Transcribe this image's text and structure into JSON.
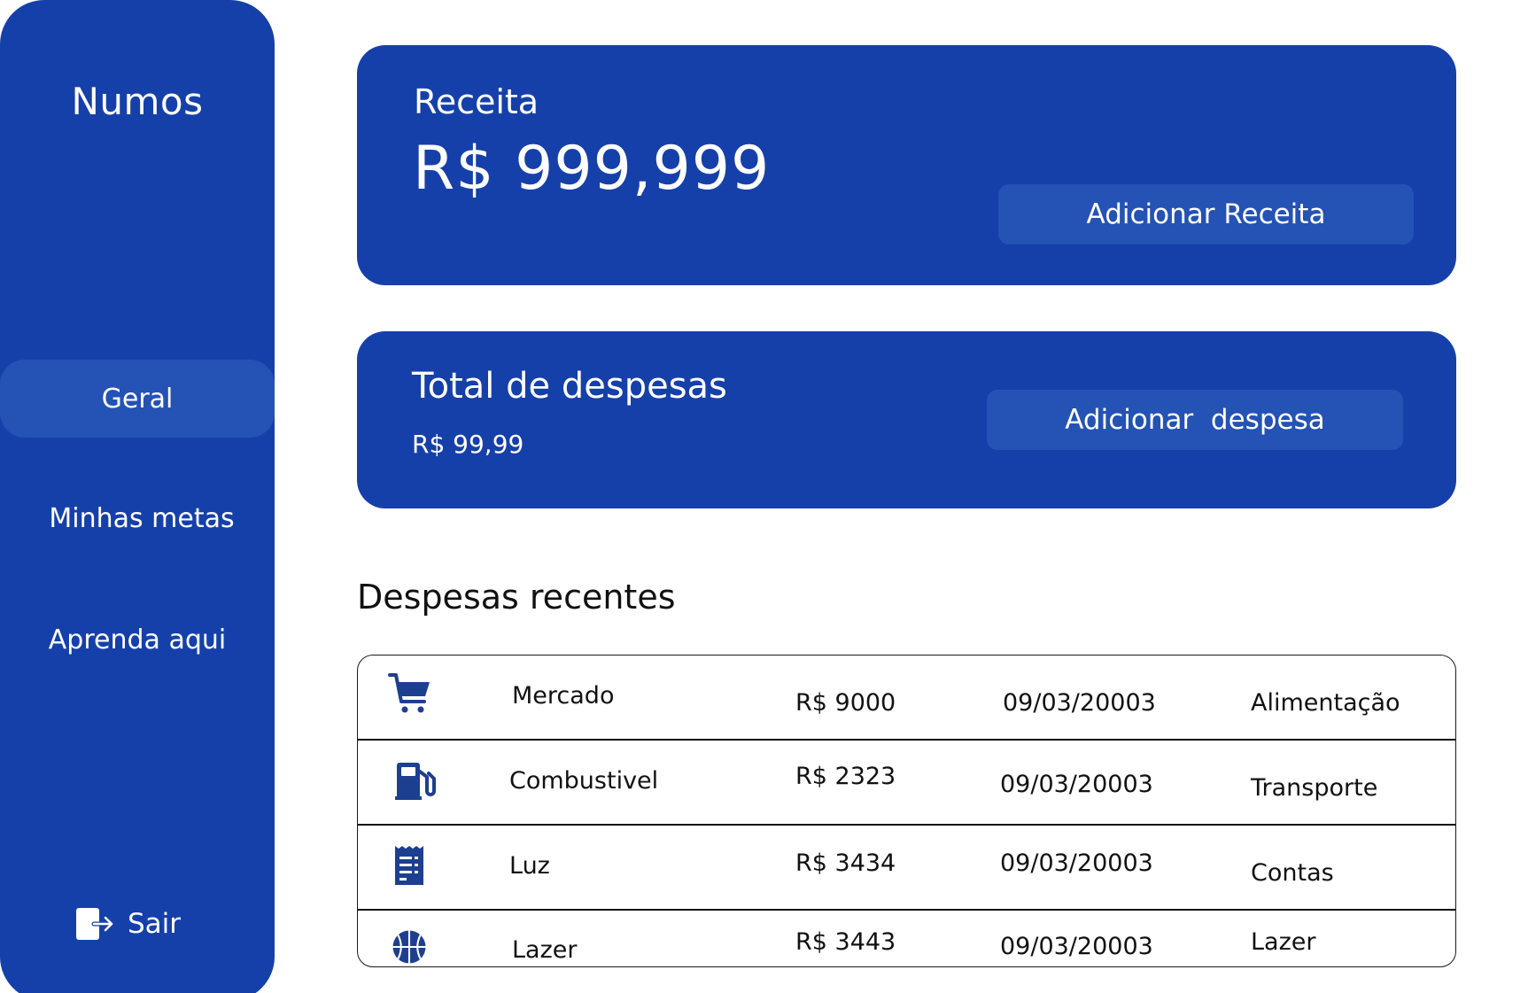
{
  "sidebar": {
    "brand": "Numos",
    "items": [
      {
        "label": "Geral",
        "active": true
      },
      {
        "label": "Minhas metas",
        "active": false
      },
      {
        "label": "Aprenda aqui",
        "active": false
      }
    ],
    "logout_label": "Sair",
    "logout_icon": "logout-icon"
  },
  "receita": {
    "title": "Receita",
    "value": "R$ 999,999",
    "button_label": "Adicionar Receita"
  },
  "despesas": {
    "title": "Total de despesas",
    "value": "R$ 99,99",
    "button_label": "Adicionar  despesa"
  },
  "recent": {
    "title": "Despesas recentes",
    "rows": [
      {
        "icon": "cart-icon",
        "name": "Mercado",
        "amount": "R$ 9000",
        "date": "09/03/20003",
        "category": "Alimentação"
      },
      {
        "icon": "fuel-icon",
        "name": "Combustivel",
        "amount": "R$ 2323",
        "date": "09/03/20003",
        "category": "Transporte"
      },
      {
        "icon": "receipt-icon",
        "name": "Luz",
        "amount": "R$ 3434",
        "date": "09/03/20003",
        "category": "Contas"
      },
      {
        "icon": "basketball-icon",
        "name": "Lazer",
        "amount": "R$ 3443",
        "date": "09/03/20003",
        "category": "Lazer"
      }
    ]
  },
  "colors": {
    "primary": "#1640a9",
    "primary_light": "#2452b5",
    "icon": "#1d3f8f",
    "text_dark": "#111111"
  }
}
